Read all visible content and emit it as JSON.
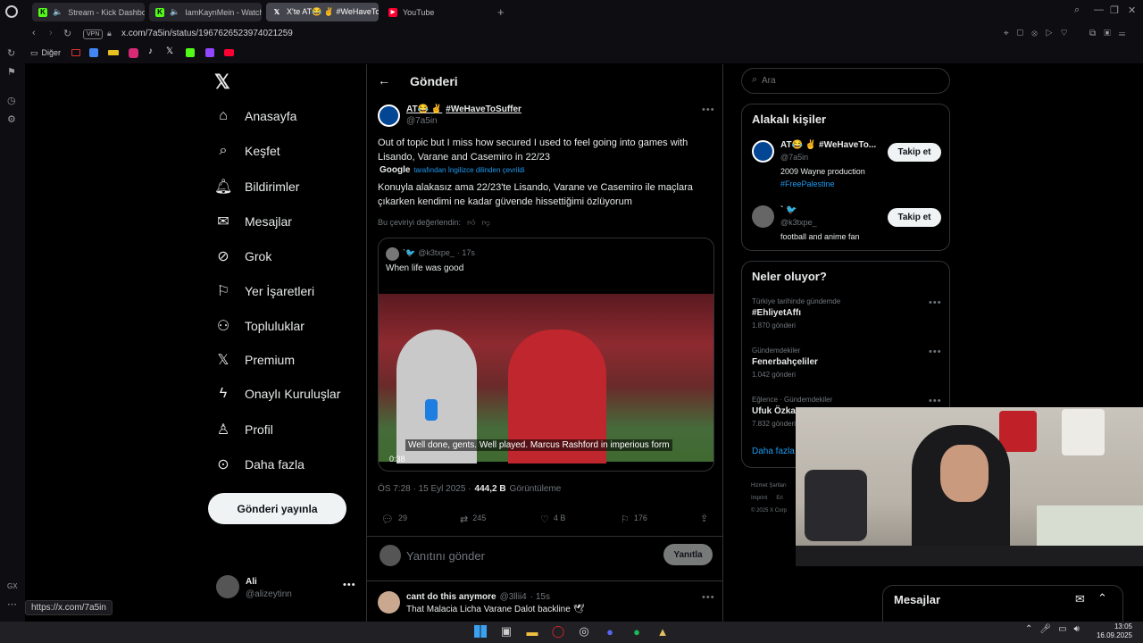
{
  "browser": {
    "tabs": [
      {
        "label": "Stream - Kick Dashbo",
        "icon": "kick-logo-icon"
      },
      {
        "label": "IamKaynMein - Watch",
        "icon": "kick-logo-icon"
      },
      {
        "label": "X'te AT😂 ✌ #WeHaveTo",
        "icon": "x-logo-icon"
      },
      {
        "label": "YouTube",
        "icon": "youtube-logo-icon"
      }
    ],
    "url": "x.com/7a5in/status/1967626523974021259",
    "vpn": "VPN",
    "bookmark_folder": "Diğer",
    "status_url": "https://x.com/7a5in",
    "gx_label": "GX"
  },
  "sidebar": {
    "items": [
      {
        "label": "Anasayfa",
        "icon": "home-icon"
      },
      {
        "label": "Keşfet",
        "icon": "search-icon"
      },
      {
        "label": "Bildirimler",
        "icon": "bell-icon"
      },
      {
        "label": "Mesajlar",
        "icon": "mail-icon"
      },
      {
        "label": "Grok",
        "icon": "grok-icon"
      },
      {
        "label": "Yer İşaretleri",
        "icon": "bookmark-icon"
      },
      {
        "label": "Topluluklar",
        "icon": "communities-icon"
      },
      {
        "label": "Premium",
        "icon": "x-logo-icon"
      },
      {
        "label": "Onaylı Kuruluşlar",
        "icon": "lightning-icon"
      },
      {
        "label": "Profil",
        "icon": "person-icon"
      },
      {
        "label": "Daha fazla",
        "icon": "more-circle-icon"
      }
    ],
    "post_button": "Gönderi yayınla",
    "account": {
      "name": "Ali",
      "handle": "@alizeytinn"
    }
  },
  "post": {
    "header_title": "Gönderi",
    "author_name": "AT😂 ✌",
    "author_hashtag": "#WeHaveToSuffer",
    "author_handle": "@7a5in",
    "text": "Out of topic but I miss how secured I used to feel going into games with Lisando, Varane and Casemiro in 22/23",
    "translated_by": "Google",
    "translated_note": "tarafından İngilizce dilinden çevrildi",
    "translation": "Konuyla alakasız ama 22/23'te Lisando, Varane ve Casemiro ile maçlara çıkarken kendimi ne kadar güvende hissettiğimi özlüyorum",
    "rate_translation": "Bu çeviriyi değerlendin:",
    "quote": {
      "handle": "@k3txpe_",
      "time": "· 17s",
      "text": "When life was good",
      "subtitle": "Well done, gents. Well played. Marcus Rashford in imperious form",
      "duration": "0:38"
    },
    "timestamp": "ÖS 7:28 · 15 Eyl 2025 ·",
    "views_count": "444,2 B",
    "views_label": "Görüntüleme",
    "replies": "29",
    "reposts": "245",
    "likes": "4 B",
    "bookmarks": "176",
    "reply_placeholder": "Yanıtını gönder",
    "reply_button": "Yanıtla"
  },
  "reply": {
    "name": "cant do this anymore",
    "handle": "@3llii4",
    "time": "· 15s",
    "text": "That Malacia Licha Varane Dalot backline 🕊"
  },
  "right": {
    "search_placeholder": "Ara",
    "related_title": "Alakalı kişiler",
    "people": [
      {
        "name": "AT😂 ✌ #WeHaveTo...",
        "handle": "@7a5in",
        "bio": "2009 Wayne production",
        "bio_link": "#FreePalestine",
        "follow": "Takip et"
      },
      {
        "name": "` 🐦",
        "handle": "@k3txpe_",
        "bio": "football and anime fan",
        "bio_link": "",
        "follow": "Takip et"
      }
    ],
    "trends_title": "Neler oluyor?",
    "trends": [
      {
        "context": "Türkiye tarihinde gündemde",
        "name": "#EhliyetAffı",
        "count": "1.870 gönderi"
      },
      {
        "context": "Gündemdekiler",
        "name": "Fenerbahçeliler",
        "count": "1.042 gönderi"
      },
      {
        "context": "Eğlence · Gündemdekiler",
        "name": "Ufuk Özka",
        "count": "7.832 gönderi"
      }
    ],
    "show_more": "Daha fazla",
    "footer": [
      "Hizmet Şartları",
      "Imprint",
      "Eri",
      "© 2025 X Corp"
    ],
    "messages_title": "Mesajlar"
  },
  "taskbar": {
    "time": "13:05",
    "date": "16.09.2025"
  },
  "colors": {
    "accent": "#1d9bf0",
    "kick": "#53fc18",
    "youtube": "#ff0033",
    "opera": "#e0262b"
  }
}
